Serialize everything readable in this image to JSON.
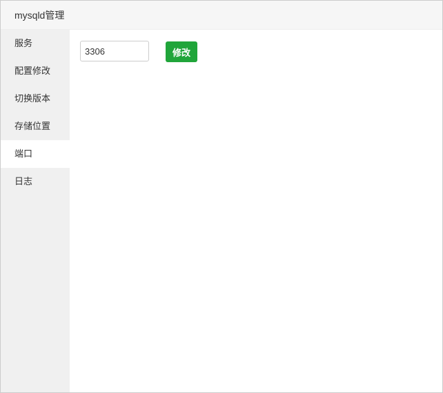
{
  "header": {
    "title": "mysqld管理"
  },
  "sidebar": {
    "items": [
      {
        "label": "服务"
      },
      {
        "label": "配置修改"
      },
      {
        "label": "切换版本"
      },
      {
        "label": "存储位置"
      },
      {
        "label": "端口",
        "active": true
      },
      {
        "label": "日志"
      }
    ]
  },
  "main": {
    "port_value": "3306",
    "submit_label": "修改"
  }
}
